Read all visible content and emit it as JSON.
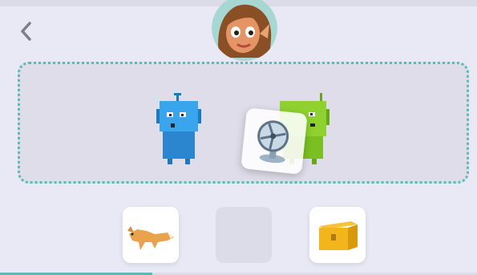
{
  "colors": {
    "background": "#e9e9f5",
    "dropzone_border": "#5cb9b3",
    "dropzone_fill": "#dedde9",
    "robot_blue": "#2f95dd",
    "robot_green": "#8fd12f",
    "progress": "#5cb9b3"
  },
  "icons": {
    "back": "chevron-left-icon",
    "avatar": "girl-avatar",
    "dragged": "desk-fan-icon",
    "slot_left": "fox-icon",
    "slot_right": "treasure-box-icon"
  },
  "progress": {
    "fraction": 0.32
  }
}
